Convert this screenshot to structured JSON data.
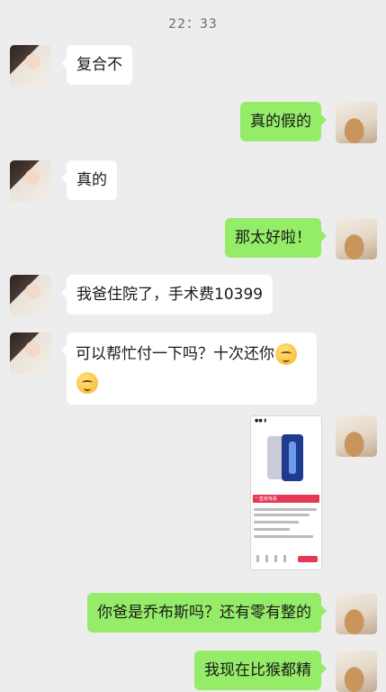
{
  "time": "22：33",
  "messages": [
    {
      "side": "in",
      "text": "复合不"
    },
    {
      "side": "out",
      "text": "真的假的"
    },
    {
      "side": "in",
      "text": "真的"
    },
    {
      "side": "out",
      "text": "那太好啦！"
    },
    {
      "side": "in",
      "text": "我爸住院了，手术费10399"
    },
    {
      "side": "in",
      "text": "可以帮忙付一下吗？十次还你"
    },
    {
      "side": "out",
      "type": "image",
      "price_text": "一直有惊喜"
    },
    {
      "side": "out",
      "text": "你爸是乔布斯吗？还有零有整的"
    },
    {
      "side": "out",
      "text": "我现在比猴都精"
    }
  ],
  "emoji": "smiling-face-emoji",
  "colors": {
    "background": "#ededed",
    "incoming": "#ffffff",
    "outgoing": "#95ec69",
    "price_bar": "#e43855"
  }
}
